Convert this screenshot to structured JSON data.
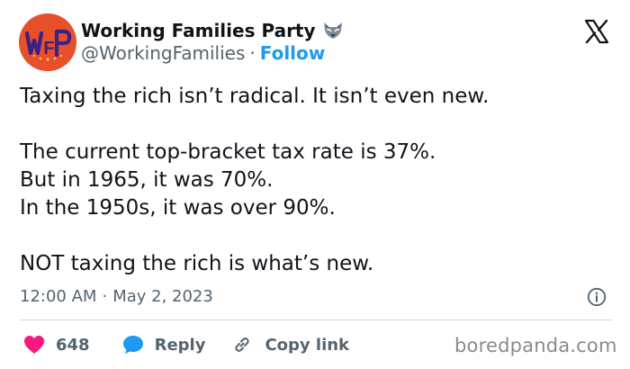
{
  "author": {
    "display_name": "Working Families Party",
    "handle": "@WorkingFamilies",
    "separator": "·",
    "follow_label": "Follow",
    "avatar_logo_text": "WFP",
    "avatar_color": "#e8502b",
    "avatar_text_color": "#3b2184",
    "badge_icon": "fox-icon"
  },
  "platform_icon": "x-logo-icon",
  "tweet": {
    "lines": [
      "Taxing the rich isn’t radical. It isn’t even new.",
      "The current top-bracket tax rate is 37%.",
      "But in 1965, it was 70%.",
      "In the 1950s, it was over 90%.",
      "NOT taxing the rich is what’s new."
    ],
    "time": "12:00 AM",
    "separator": "·",
    "date": "May 2, 2023",
    "info_icon": "info-icon"
  },
  "actions": {
    "likes_count": "648",
    "reply_label": "Reply",
    "copy_link_label": "Copy link",
    "like_color": "#f91880",
    "reply_color": "#1d9bf0",
    "link_color": "#536471"
  },
  "watermark": "boredpanda.com",
  "colors": {
    "text": "#0f1419",
    "secondary": "#536471",
    "accent": "#1d9bf0",
    "divider": "#cfd9de"
  }
}
